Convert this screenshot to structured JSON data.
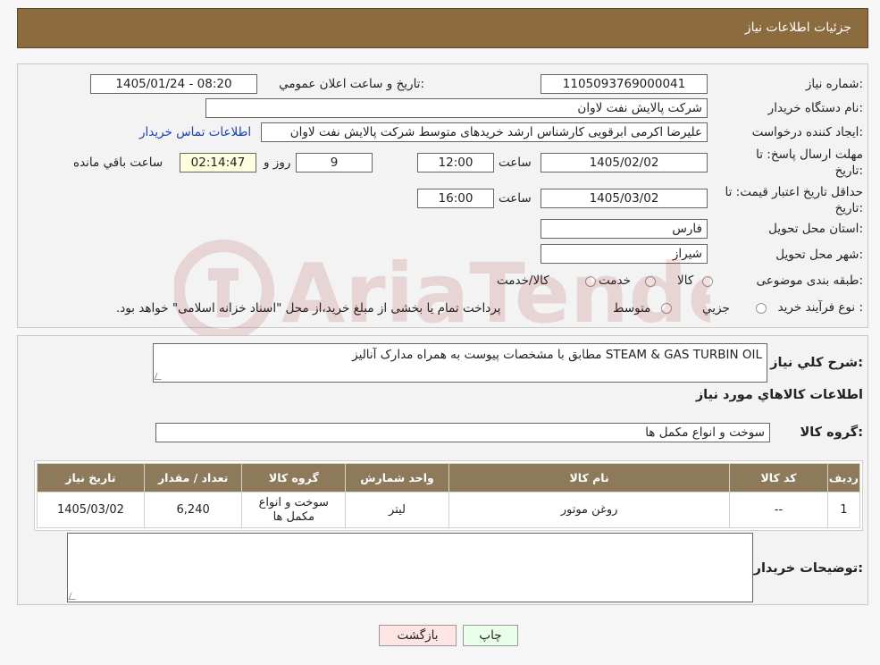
{
  "header": {
    "title": "جزئیات اطلاعات نیاز"
  },
  "form": {
    "need_number_label": "شماره نیاز:",
    "need_number": "1105093769000041",
    "announce_label": "تاریخ و ساعت اعلان عمومي:",
    "announce_value": "1405/01/24 - 08:20",
    "buyer_org_label": "نام دستگاه خريدار:",
    "buyer_org": "شرکت پالايش نفت لاوان",
    "creator_label": "ايجاد کننده درخواست:",
    "creator": "عليرضا اکرمی ابرقويی کارشناس ارشد خريدهای متوسط شرکت پالايش نفت لاوان",
    "contact_link": "اطلاعات تماس خريدار",
    "deadline_label_1": "مهلت ارسال پاسخ: تا",
    "deadline_label_2": "تاريخ:",
    "deadline_date": "1405/02/02",
    "time_label": "ساعت",
    "deadline_time": "12:00",
    "days": "9",
    "days_label": "روز و",
    "remaining_time": "02:14:47",
    "remaining_label": "ساعت باقي مانده",
    "validity_label_1": "حداقل تاريخ اعتبار قيمت: تا",
    "validity_label_2": "تاريخ:",
    "validity_date": "1405/03/02",
    "validity_time": "16:00",
    "province_label": "استان محل تحويل:",
    "province": "فارس",
    "city_label": "شهر محل تحويل:",
    "city": "شيراز",
    "category_label": "طبقه بندی موضوعی:",
    "category_options": [
      "کالا",
      "خدمت",
      "کالا/خدمت"
    ],
    "process_label": "نوع فرآيند خريد :",
    "process_options": [
      "جزيي",
      "متوسط"
    ],
    "process_note": "پرداخت تمام يا بخشی از مبلغ خريد،از محل \"اسناد خزانه اسلامی\" خواهد بود."
  },
  "details": {
    "description_label": "شرح کلي نياز:",
    "description": "STEAM & GAS TURBIN OIL  مطابق با مشخصات پیوست به همراه مدارک آنالیز",
    "goods_info_title": "اطلاعات کالاهاي مورد نياز",
    "goods_group_label": "گروه کالا:",
    "goods_group": "سوخت و انواع مکمل ها",
    "table": {
      "headers": [
        "رديف",
        "کد کالا",
        "نام کالا",
        "واحد شمارش",
        "گروه کالا",
        "تعداد / مقدار",
        "تاريخ نياز"
      ],
      "rows": [
        [
          "1",
          "--",
          "روغن موتور",
          "ليتر",
          "سوخت و انواع مکمل ها",
          "6,240",
          "1405/03/02"
        ]
      ]
    },
    "buyer_notes_label": "توضيحات خريدار:",
    "buyer_notes": ""
  },
  "buttons": {
    "print": "چاپ",
    "back": "بازگشت"
  },
  "colors": {
    "header_bg": "#8c6b3f",
    "table_header_bg": "#8c7a5a",
    "link": "#1a3fb5",
    "print_bg": "#eaffea",
    "back_bg": "#ffe4e4"
  }
}
